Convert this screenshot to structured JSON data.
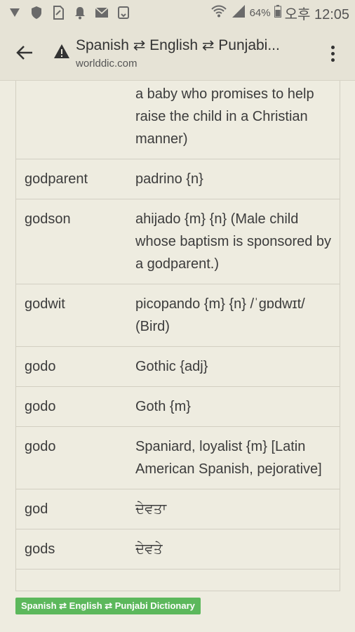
{
  "status_bar": {
    "icons": [
      "vpn-shield-icon",
      "shield-icon",
      "sim-card-icon",
      "bell-icon",
      "mail-icon",
      "screenshot-icon"
    ],
    "battery": "64%",
    "time": "오후 12:05"
  },
  "toolbar": {
    "title": "Spanish ⇄ English ⇄ Punjabi...",
    "domain": "worlddic.com"
  },
  "table": {
    "rows": [
      {
        "word": "",
        "translation": "a baby who promises to help raise the child in a Christian manner)"
      },
      {
        "word": "godparent",
        "translation": "padrino {n}"
      },
      {
        "word": "godson",
        "translation": "ahijado {m} {n} (Male child whose baptism is sponsored by a godparent.)"
      },
      {
        "word": "godwit",
        "translation": "picopando {m} {n} /ˈɡɒdwɪt/ (Bird)"
      },
      {
        "word": "godo",
        "translation": "Gothic {adj}"
      },
      {
        "word": "godo",
        "translation": "Goth {m}"
      },
      {
        "word": "godo",
        "translation": "Spaniard, loyalist {m} [Latin American Spanish, pejorative]"
      },
      {
        "word": "god",
        "translation": "ਦੇਵਤਾ"
      },
      {
        "word": "gods",
        "translation": "ਦੇਵਤੇ"
      }
    ]
  },
  "badge": "Spanish ⇄ English ⇄ Punjabi Dictionary",
  "colors": {
    "background": "#e6e3d6",
    "badge": "#5cb85c"
  }
}
